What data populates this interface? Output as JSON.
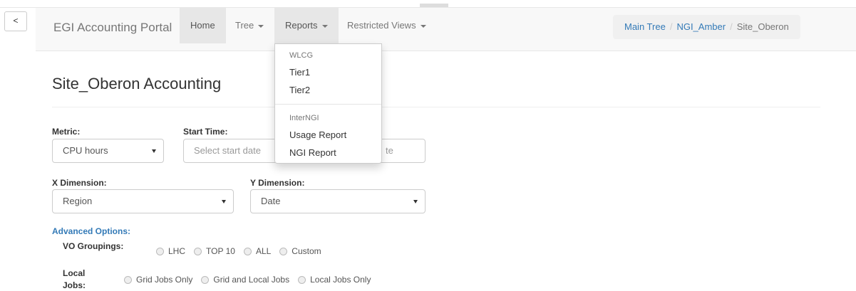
{
  "nav": {
    "back_label": "<",
    "brand": "EGI Accounting Portal",
    "home": "Home",
    "tree": "Tree",
    "reports": "Reports",
    "restricted": "Restricted Views"
  },
  "breadcrumb": {
    "items": [
      "Main Tree",
      "NGI_Amber"
    ],
    "current": "Site_Oberon",
    "separator": "/"
  },
  "reports_menu": {
    "header_1": "WLCG",
    "items_1": [
      "Tier1",
      "Tier2"
    ],
    "header_2": "InterNGI",
    "items_2": [
      "Usage Report",
      "NGI Report"
    ]
  },
  "page": {
    "title": "Site_Oberon Accounting"
  },
  "form": {
    "metric_label": "Metric:",
    "metric_value": "CPU hours",
    "start_label": "Start Time:",
    "start_placeholder": "Select start date",
    "end_placeholder_tail": "te",
    "xdim_label": "X Dimension:",
    "xdim_value": "Region",
    "ydim_label": "Y Dimension:",
    "ydim_value": "Date",
    "advanced_label": "Advanced Options:",
    "vo_label": "VO Groupings:",
    "vo_options": [
      "LHC",
      "TOP 10",
      "ALL",
      "Custom"
    ],
    "local_label_1": "Local",
    "local_label_2": "Jobs:",
    "local_options": [
      "Grid Jobs Only",
      "Grid and Local Jobs",
      "Local Jobs Only"
    ]
  },
  "colors": {
    "link": "#337ab7",
    "navbar_bg": "#f8f8f8",
    "active_bg": "#e7e7e7"
  }
}
